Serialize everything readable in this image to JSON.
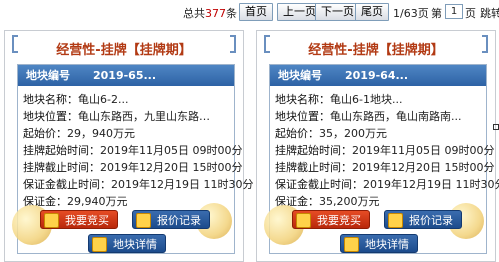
{
  "pager": {
    "total_prefix": "总共",
    "total_count": "377",
    "total_suffix": "条",
    "first": "首页",
    "prev": "上一页",
    "next": "下一页",
    "last": "尾页",
    "page_status": "1/63页",
    "goto_prefix": "第",
    "page_number": "1",
    "goto_suffix": "页",
    "jump": "跳转"
  },
  "cards": [
    {
      "title": "经营性-挂牌【挂牌期】",
      "header_label": "地块编号",
      "header_value": "2019-65...",
      "rows": [
        {
          "label": "地块名称：",
          "value": "龟山6-2..."
        },
        {
          "label": "地块位置：",
          "value": "龟山东路西，九里山东路…"
        },
        {
          "label": "起始价：",
          "value": "29，940万元"
        },
        {
          "label": "挂牌起始时间：",
          "value": "2019年11月05日 09时00分"
        },
        {
          "label": "挂牌截止时间：",
          "value": "2019年12月20日 15时00分"
        },
        {
          "label": "保证金截止时间：",
          "value": "2019年12月19日 11时30分"
        },
        {
          "label": "保证金：",
          "value": "29,940万元"
        }
      ],
      "buttons": {
        "bid": "我要竞买",
        "quote": "报价记录",
        "detail": "地块详情"
      }
    },
    {
      "title": "经营性-挂牌【挂牌期】",
      "header_label": "地块编号",
      "header_value": "2019-64...",
      "rows": [
        {
          "label": "地块名称：",
          "value": "龟山6-1地块..."
        },
        {
          "label": "地块位置：",
          "value": "龟山东路西，龟山南路南..."
        },
        {
          "label": "起始价：",
          "value": "35，200万元"
        },
        {
          "label": "挂牌起始时间：",
          "value": "2019年11月05日 09时00分"
        },
        {
          "label": "挂牌截止时间：",
          "value": "2019年12月20日 15时00分"
        },
        {
          "label": "保证金截止时间：",
          "value": "2019年12月19日 11时30分"
        },
        {
          "label": "保证金：",
          "value": "35,200万元"
        }
      ],
      "buttons": {
        "bid": "我要竞买",
        "quote": "报价记录",
        "detail": "地块详情"
      }
    }
  ],
  "colors": {
    "title": "#b23a14",
    "header": "#2d62a5",
    "bid_button": "#c8320f",
    "blue_button": "#1f4f90"
  }
}
